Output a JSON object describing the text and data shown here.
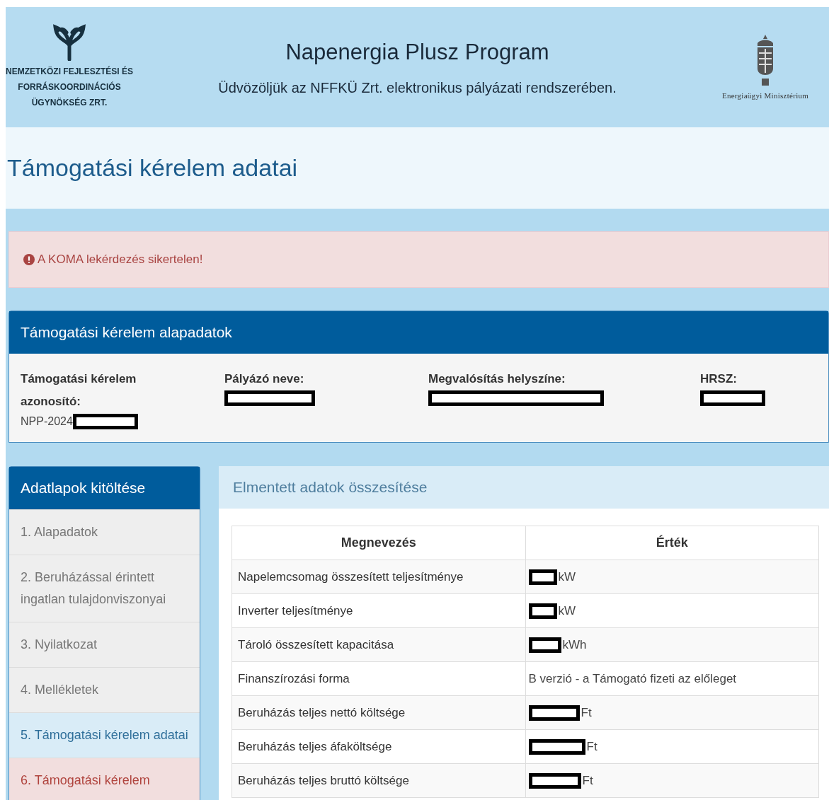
{
  "header": {
    "org_name": [
      "NEMZETKÖZI FEJLESZTÉSI ÉS",
      "FORRÁSKOORDINÁCIÓS",
      "ÜGYNÖKSÉG ZRT."
    ],
    "title": "Napenergia Plusz Program",
    "subtitle": "Üdvözöljük az NFFKÜ Zrt. elektronikus pályázati rendszerében.",
    "ministry": "Energiaügyi Minisztérium"
  },
  "page_title": "Támogatási kérelem adatai",
  "alert": {
    "text": "A KOMA lekérdezés sikertelen!"
  },
  "basic_panel": {
    "title": "Támogatási kérelem alapadatok",
    "fields": [
      {
        "label": "Támogatási kérelem azonosító:",
        "value": "NPP-2024",
        "redacted": true
      },
      {
        "label": "Pályázó neve:",
        "redacted": true
      },
      {
        "label": "Megvalósítás helyszíne:",
        "redacted": true
      },
      {
        "label": "HRSZ:",
        "redacted": true
      }
    ]
  },
  "sidebar": {
    "title": "Adatlapok kitöltése",
    "items": [
      {
        "label": "1. Alapadatok",
        "selected": false,
        "error": false
      },
      {
        "label": "2. Beruházással érintett ingatlan tulajdonviszonyai",
        "selected": false,
        "error": false
      },
      {
        "label": "3. Nyilatkozat",
        "selected": false,
        "error": false
      },
      {
        "label": "4. Mellékletek",
        "selected": false,
        "error": false
      },
      {
        "label": "5. Támogatási kérelem adatai",
        "selected": true,
        "error": false
      },
      {
        "label": "6. Támogatási kérelem",
        "selected": false,
        "error": true
      }
    ]
  },
  "summary": {
    "title": "Elmentett adatok összesítése",
    "columns": [
      "Megnevezés",
      "Érték"
    ],
    "rows": [
      {
        "name": "Napelemcsomag összesített teljesítménye",
        "value": "kW",
        "redacted": true
      },
      {
        "name": "Inverter teljesítménye",
        "value": "kW",
        "redacted": true
      },
      {
        "name": "Tároló összesített kapacitása",
        "value": "kWh",
        "redacted": true
      },
      {
        "name": "Finanszírozási forma",
        "value": "B verzió - a Támogató fizeti az előleget",
        "redacted": false
      },
      {
        "name": "Beruházás teljes nettó költsége",
        "value": "Ft",
        "redacted": true
      },
      {
        "name": "Beruházás teljes áfaköltsége",
        "value": "Ft",
        "redacted": true
      },
      {
        "name": "Beruházás teljes bruttó költsége",
        "value": "Ft",
        "redacted": true
      }
    ]
  }
}
